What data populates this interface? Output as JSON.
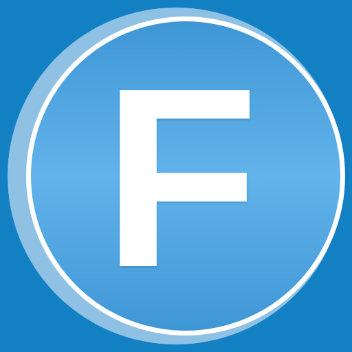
{
  "app_icon": {
    "letter": "F",
    "colors": {
      "background": "#1380c4",
      "outer_ring": "#8ec1e3",
      "white_ring": "#ffffff",
      "disc_top": "#3f96d6",
      "disc_middle": "#62b3ea",
      "disc_bottom": "#3f96d6",
      "letter": "#ffffff"
    }
  }
}
